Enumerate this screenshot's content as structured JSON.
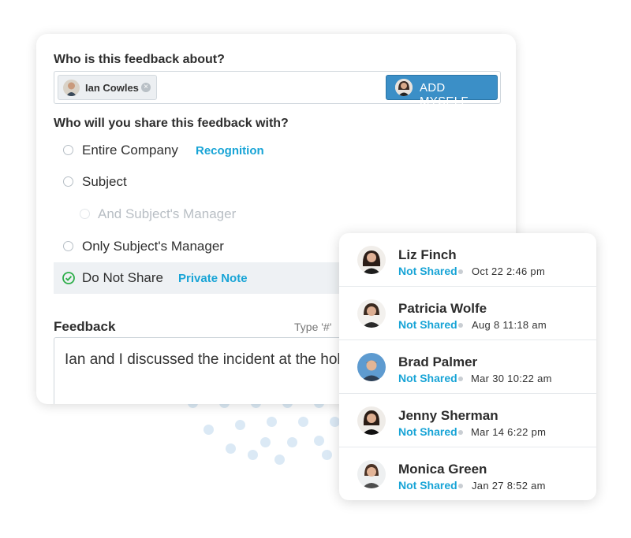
{
  "subject_question": "Who is this feedback about?",
  "subject_chip": {
    "name": "Ian Cowles",
    "remove_icon": "×"
  },
  "add_myself_label": "ADD MYSELF",
  "share_question": "Who will you share this feedback with?",
  "options": [
    {
      "label": "Entire Company",
      "tag": "Recognition",
      "selected": false
    },
    {
      "label": "Subject",
      "tag": "",
      "selected": false
    },
    {
      "label": "And Subject's Manager",
      "tag": "",
      "selected": false,
      "disabled": true
    },
    {
      "label": "Only Subject's Manager",
      "tag": "",
      "selected": false
    },
    {
      "label": "Do Not Share",
      "tag": "Private Note",
      "selected": true
    }
  ],
  "feedback_label": "Feedback",
  "feedback_hint": "Type '#'",
  "feedback_text": "Ian and I discussed the incident at the holiday party",
  "people": [
    {
      "name": "Liz Finch",
      "status": "Not Shared",
      "date": "Oct 22  2:46 pm"
    },
    {
      "name": "Patricia Wolfe",
      "status": "Not Shared",
      "date": "Aug 8  11:18 am"
    },
    {
      "name": "Brad Palmer",
      "status": "Not Shared",
      "date": "Mar 30  10:22 am"
    },
    {
      "name": "Jenny Sherman",
      "status": "Not Shared",
      "date": "Mar 14  6:22 pm"
    },
    {
      "name": "Monica Green",
      "status": "Not Shared",
      "date": "Jan 27  8:52 am"
    }
  ],
  "colors": {
    "accent": "#18a4d6",
    "button": "#3b8fc7",
    "check": "#2eae4a",
    "dots": "#dbe9f5"
  }
}
